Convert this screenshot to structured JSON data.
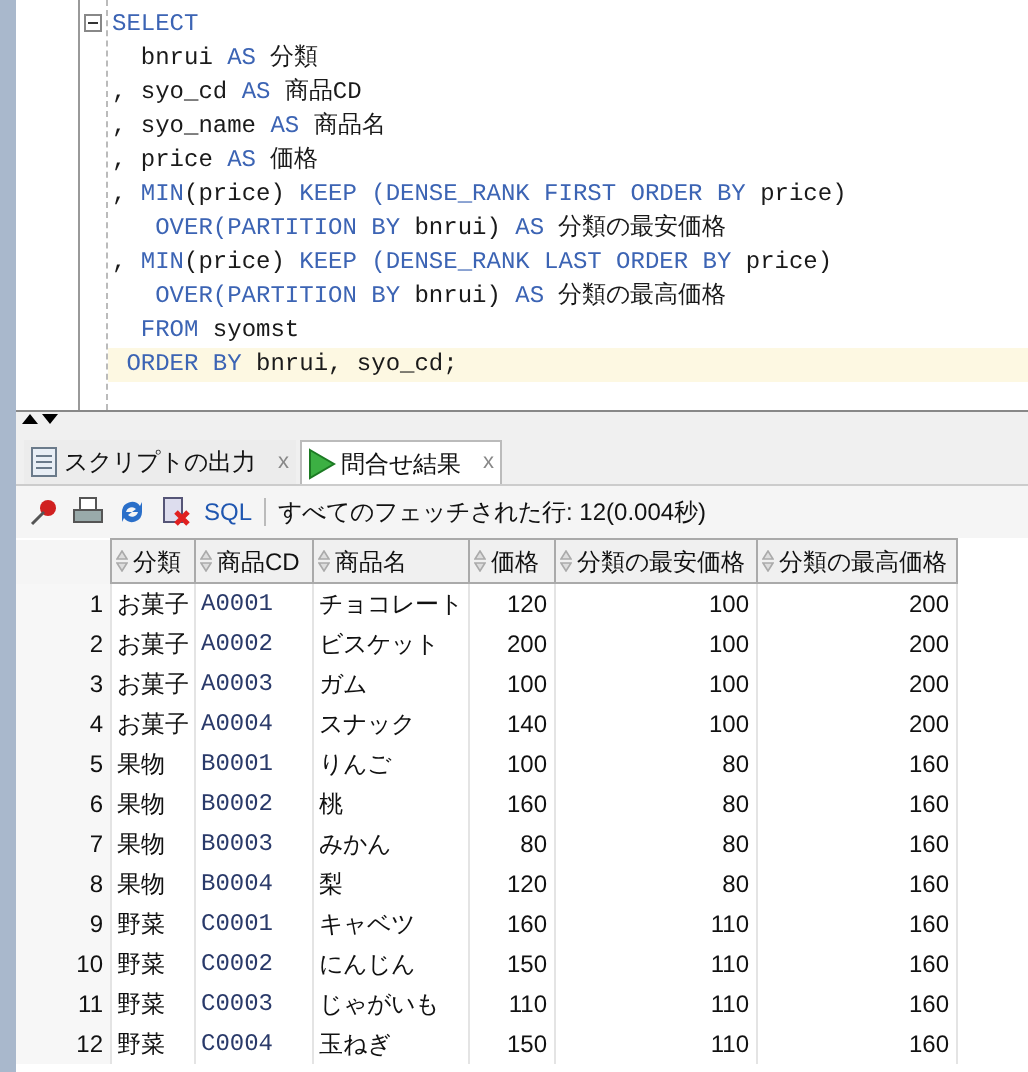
{
  "editor": {
    "lines": [
      {
        "highlighted": false,
        "tokens": [
          {
            "text": "SELECT",
            "kind": "keyword"
          }
        ]
      },
      {
        "highlighted": false,
        "tokens": [
          {
            "text": "  bnrui ",
            "kind": "plain"
          },
          {
            "text": "AS",
            "kind": "keyword"
          },
          {
            "text": " 分類",
            "kind": "plain"
          }
        ]
      },
      {
        "highlighted": false,
        "tokens": [
          {
            "text": ", syo_cd ",
            "kind": "plain"
          },
          {
            "text": "AS",
            "kind": "keyword"
          },
          {
            "text": " 商品CD",
            "kind": "plain"
          }
        ]
      },
      {
        "highlighted": false,
        "tokens": [
          {
            "text": ", syo_name ",
            "kind": "plain"
          },
          {
            "text": "AS",
            "kind": "keyword"
          },
          {
            "text": " 商品名",
            "kind": "plain"
          }
        ]
      },
      {
        "highlighted": false,
        "tokens": [
          {
            "text": ", price ",
            "kind": "plain"
          },
          {
            "text": "AS",
            "kind": "keyword"
          },
          {
            "text": " 価格",
            "kind": "plain"
          }
        ]
      },
      {
        "highlighted": false,
        "tokens": [
          {
            "text": ", ",
            "kind": "plain"
          },
          {
            "text": "MIN",
            "kind": "keyword"
          },
          {
            "text": "(price) ",
            "kind": "plain"
          },
          {
            "text": "KEEP (DENSE_RANK FIRST ORDER BY",
            "kind": "keyword"
          },
          {
            "text": " price)",
            "kind": "plain"
          }
        ]
      },
      {
        "highlighted": false,
        "tokens": [
          {
            "text": "   OVER(PARTITION BY",
            "kind": "keyword"
          },
          {
            "text": " bnrui) ",
            "kind": "plain"
          },
          {
            "text": "AS",
            "kind": "keyword"
          },
          {
            "text": " 分類の最安価格",
            "kind": "plain"
          }
        ]
      },
      {
        "highlighted": false,
        "tokens": [
          {
            "text": ", ",
            "kind": "plain"
          },
          {
            "text": "MIN",
            "kind": "keyword"
          },
          {
            "text": "(price) ",
            "kind": "plain"
          },
          {
            "text": "KEEP (DENSE_RANK LAST ORDER BY",
            "kind": "keyword"
          },
          {
            "text": " price)",
            "kind": "plain"
          }
        ]
      },
      {
        "highlighted": false,
        "tokens": [
          {
            "text": "   OVER(PARTITION BY",
            "kind": "keyword"
          },
          {
            "text": " bnrui) ",
            "kind": "plain"
          },
          {
            "text": "AS",
            "kind": "keyword"
          },
          {
            "text": " 分類の最高価格",
            "kind": "plain"
          }
        ]
      },
      {
        "highlighted": false,
        "tokens": [
          {
            "text": "  FROM",
            "kind": "keyword"
          },
          {
            "text": " syomst",
            "kind": "plain"
          }
        ]
      },
      {
        "highlighted": true,
        "tokens": [
          {
            "text": " ORDER BY",
            "kind": "keyword"
          },
          {
            "text": " bnrui, syo_cd;",
            "kind": "plain"
          }
        ]
      }
    ]
  },
  "tabs": [
    {
      "label": "スクリプトの出力",
      "close": "x",
      "selected": false
    },
    {
      "label": "問合せ結果",
      "close": "x",
      "selected": true
    }
  ],
  "toolbar": {
    "sql_link": "SQL",
    "status": "すべてのフェッチされた行: 12(0.004秒)"
  },
  "table": {
    "columns": [
      "",
      "分類",
      "商品CD",
      "商品名",
      "価格",
      "分類の最安価格",
      "分類の最高価格"
    ],
    "rows": [
      [
        "1",
        "お菓子",
        "A0001",
        "チョコレート",
        "120",
        "100",
        "200"
      ],
      [
        "2",
        "お菓子",
        "A0002",
        "ビスケット",
        "200",
        "100",
        "200"
      ],
      [
        "3",
        "お菓子",
        "A0003",
        "ガム",
        "100",
        "100",
        "200"
      ],
      [
        "4",
        "お菓子",
        "A0004",
        "スナック",
        "140",
        "100",
        "200"
      ],
      [
        "5",
        "果物",
        "B0001",
        "りんご",
        "100",
        "80",
        "160"
      ],
      [
        "6",
        "果物",
        "B0002",
        "桃",
        "160",
        "80",
        "160"
      ],
      [
        "7",
        "果物",
        "B0003",
        "みかん",
        "80",
        "80",
        "160"
      ],
      [
        "8",
        "果物",
        "B0004",
        "梨",
        "120",
        "80",
        "160"
      ],
      [
        "9",
        "野菜",
        "C0001",
        "キャベツ",
        "160",
        "110",
        "160"
      ],
      [
        "10",
        "野菜",
        "C0002",
        "にんじん",
        "150",
        "110",
        "160"
      ],
      [
        "11",
        "野菜",
        "C0003",
        "じゃがいも",
        "110",
        "110",
        "160"
      ],
      [
        "12",
        "野菜",
        "C0004",
        "玉ねぎ",
        "150",
        "110",
        "160"
      ]
    ]
  }
}
